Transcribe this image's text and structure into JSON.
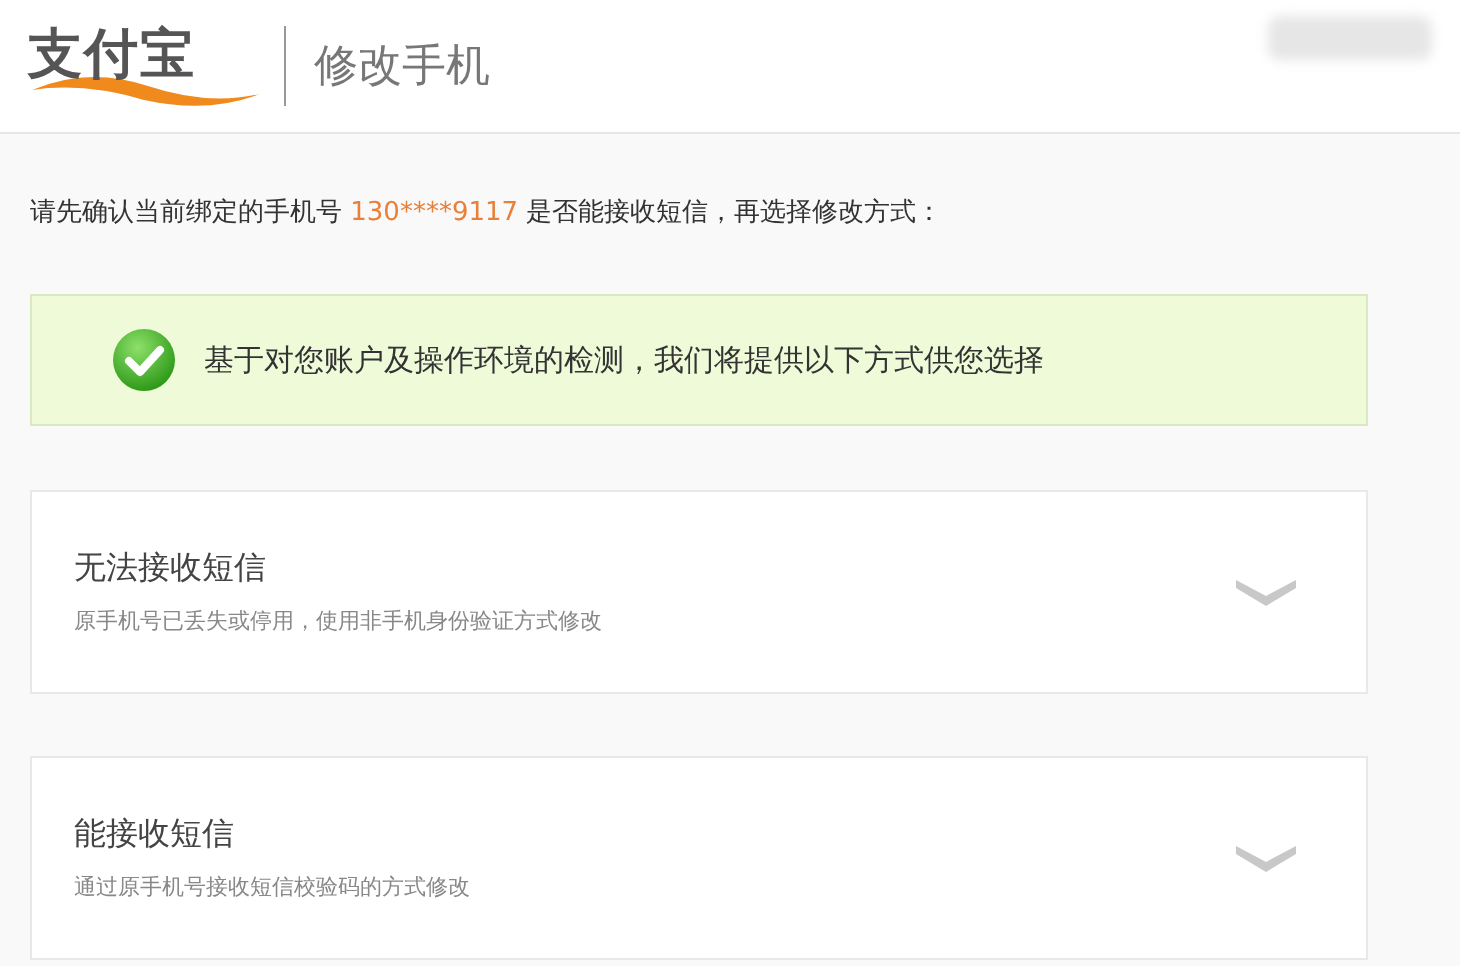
{
  "header": {
    "logo": "支付宝",
    "title": "修改手机"
  },
  "intro": {
    "before": "请先确认当前绑定的手机号",
    "phone": "130****9117",
    "after": "是否能接收短信，再选择修改方式："
  },
  "notice": {
    "text": "基于对您账户及操作环境的检测，我们将提供以下方式供您选择"
  },
  "options": [
    {
      "title": "无法接收短信",
      "description": "原手机号已丢失或停用，使用非手机身份验证方式修改",
      "expanded": false
    },
    {
      "title": "能接收短信",
      "description": "通过原手机号接收短信校验码的方式修改",
      "expanded": false
    }
  ]
}
